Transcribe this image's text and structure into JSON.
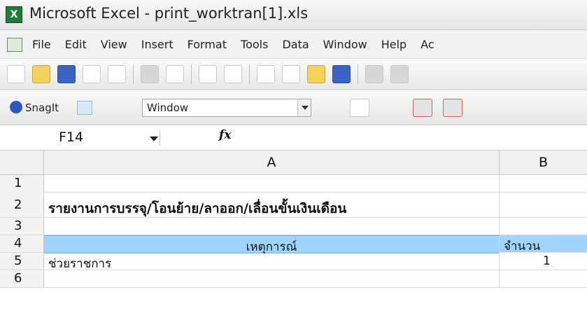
{
  "window": {
    "title": "Microsoft Excel - print_worktran[1].xls",
    "app_icon": "excel-icon"
  },
  "menu": {
    "items": [
      "File",
      "Edit",
      "View",
      "Insert",
      "Format",
      "Tools",
      "Data",
      "Window",
      "Help",
      "Ac"
    ]
  },
  "toolbar": {
    "snagit_label": "SnagIt",
    "window_select": "Window"
  },
  "formula_bar": {
    "name_box": "F14",
    "fx": "fx",
    "formula": ""
  },
  "sheet": {
    "columns": [
      "A",
      "B"
    ],
    "rows": [
      {
        "num": "1",
        "a": "",
        "b": ""
      },
      {
        "num": "2",
        "a": "รายงานการบรรจุ/โอนย้าย/ลาออก/เลื่อนขั้นเงินเดือน",
        "b": ""
      },
      {
        "num": "3",
        "a": "",
        "b": ""
      },
      {
        "num": "4",
        "a": "เหตุการณ์",
        "b": "จำนวน"
      },
      {
        "num": "5",
        "a": "ช่วยราชการ",
        "b": "1"
      },
      {
        "num": "6",
        "a": "",
        "b": ""
      }
    ]
  },
  "colors": {
    "header_fill": "#9fd5ff",
    "excel_green": "#1e7b3a"
  }
}
